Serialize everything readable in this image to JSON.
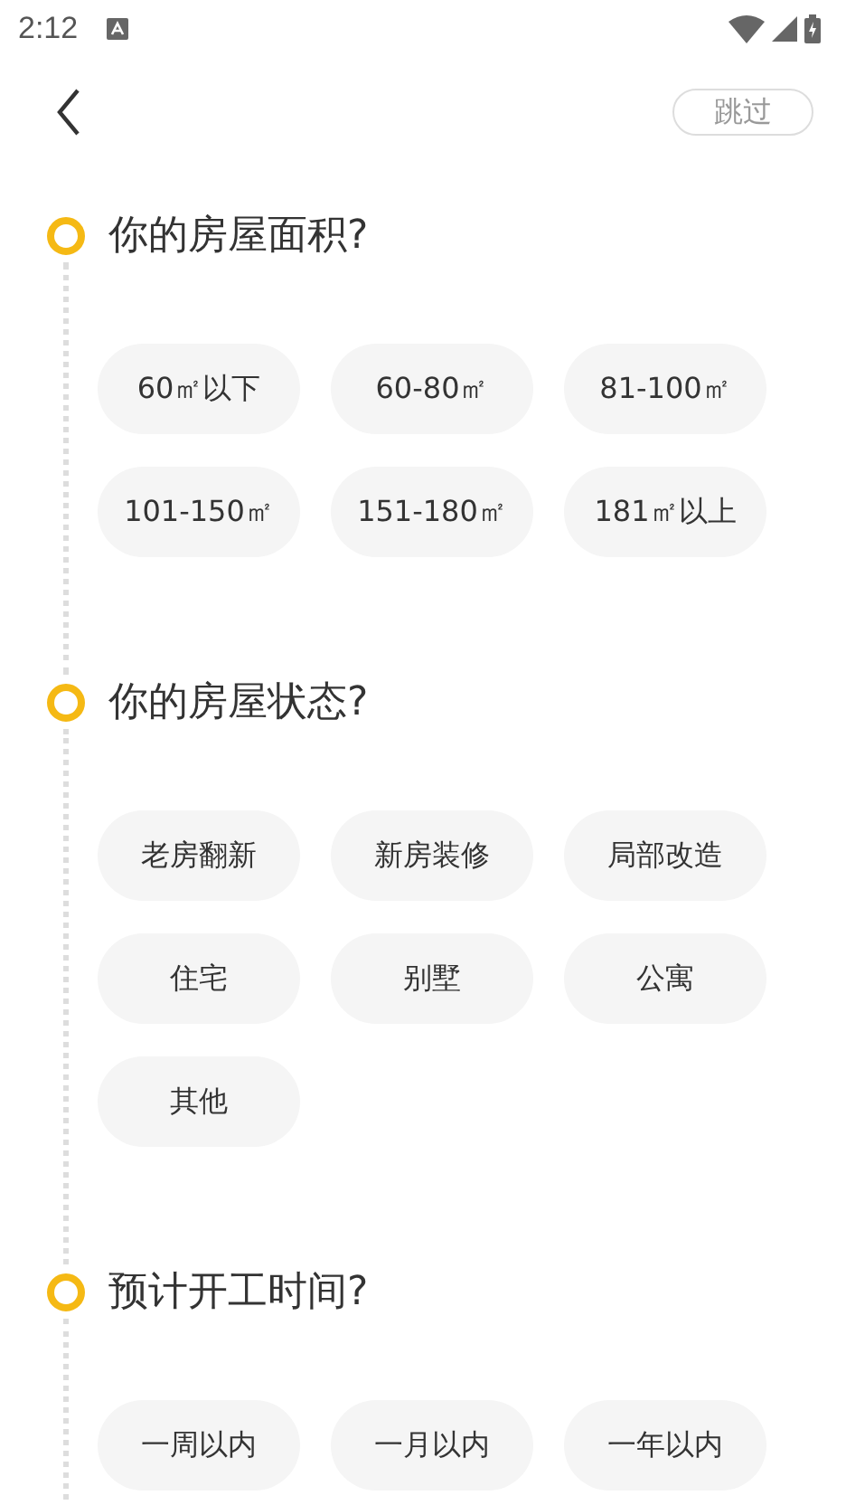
{
  "status_bar": {
    "time": "2:12"
  },
  "header": {
    "skip_label": "跳过"
  },
  "sections": [
    {
      "title": "你的房屋面积?",
      "options": [
        {
          "label": "60㎡以下",
          "selected": false
        },
        {
          "label": "60-80㎡",
          "selected": false
        },
        {
          "label": "81-100㎡",
          "selected": false
        },
        {
          "label": "101-150㎡",
          "selected": false
        },
        {
          "label": "151-180㎡",
          "selected": false
        },
        {
          "label": "181㎡以上",
          "selected": false
        }
      ]
    },
    {
      "title": "你的房屋状态?",
      "options": [
        {
          "label": "老房翻新",
          "selected": false
        },
        {
          "label": "新房装修",
          "selected": false
        },
        {
          "label": "局部改造",
          "selected": false
        },
        {
          "label": "住宅",
          "selected": false
        },
        {
          "label": "别墅",
          "selected": false
        },
        {
          "label": "公寓",
          "selected": false
        },
        {
          "label": "其他",
          "selected": false
        }
      ]
    },
    {
      "title": "预计开工时间?",
      "options": [
        {
          "label": "一周以内",
          "selected": false
        },
        {
          "label": "一月以内",
          "selected": false
        },
        {
          "label": "一年以内",
          "selected": false
        }
      ]
    }
  ]
}
